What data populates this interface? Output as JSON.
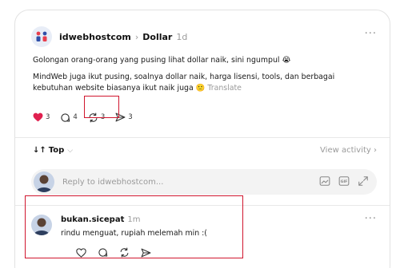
{
  "post": {
    "author": "idwebhostcom",
    "separator": "›",
    "community": "Dollar",
    "time": "1d",
    "more": "···",
    "line1": "Golongan orang-orang yang pusing lihat dollar naik, sini ngumpul 😭",
    "line2": "MindWeb juga ikut pusing, soalnya dollar naik, harga lisensi, tools, dan berbagai kebutuhan website biasanya ikut naik juga 🙁",
    "translate": "Translate",
    "likes": "3",
    "replies": "4",
    "reposts": "3",
    "shares": "3",
    "like_color": "#e0204f"
  },
  "sort": {
    "icon": "↓↑",
    "label": "Top",
    "chevron": "⌵",
    "view_activity": "View activity ›"
  },
  "reply": {
    "placeholder": "Reply to idwebhostcom..."
  },
  "comment": {
    "author": "bukan.sicepat",
    "time": "1m",
    "text": "rindu menguat, rupiah melemah min :(",
    "more": "···"
  },
  "highlight_color": "#d0162e"
}
